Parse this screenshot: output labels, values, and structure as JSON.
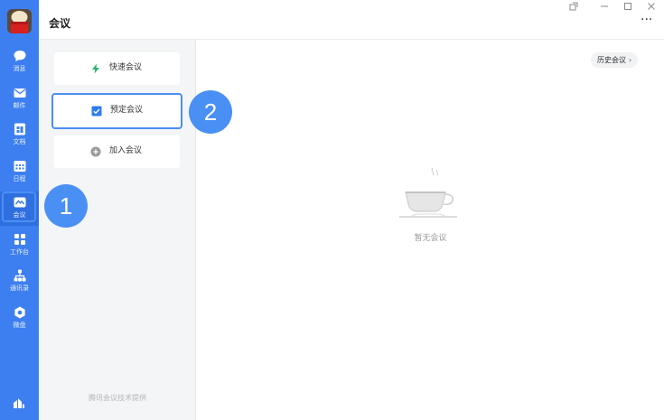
{
  "header": {
    "title": "会议",
    "more": "···"
  },
  "window_controls": [
    "share-window-icon",
    "minimize-icon",
    "maximize-icon",
    "close-icon"
  ],
  "rail": {
    "items": [
      {
        "label": "消息",
        "icon": "chat-bubble-icon"
      },
      {
        "label": "邮件",
        "icon": "mail-icon"
      },
      {
        "label": "文档",
        "icon": "document-icon"
      },
      {
        "label": "日程",
        "icon": "calendar-icon"
      },
      {
        "label": "会议",
        "icon": "meeting-icon",
        "active": true
      },
      {
        "label": "工作台",
        "icon": "workbench-icon"
      },
      {
        "label": "通讯录",
        "icon": "contacts-icon"
      },
      {
        "label": "微盘",
        "icon": "drive-icon"
      }
    ],
    "bottom_icon": "analytics-icon"
  },
  "panel": {
    "actions": [
      {
        "label": "快速会议",
        "icon": "lightning-icon"
      },
      {
        "label": "预定会议",
        "icon": "checkbox-icon",
        "selected": true
      },
      {
        "label": "加入会议",
        "icon": "plus-circle-icon"
      }
    ],
    "footer": "腾讯会议技术提供"
  },
  "content": {
    "history_button": "历史会议",
    "empty_text": "暂无会议"
  },
  "callouts": [
    "1",
    "2"
  ],
  "colors": {
    "accent": "#3d7ff0",
    "callout": "#4a8ff3",
    "lightning": "#2bb673"
  }
}
